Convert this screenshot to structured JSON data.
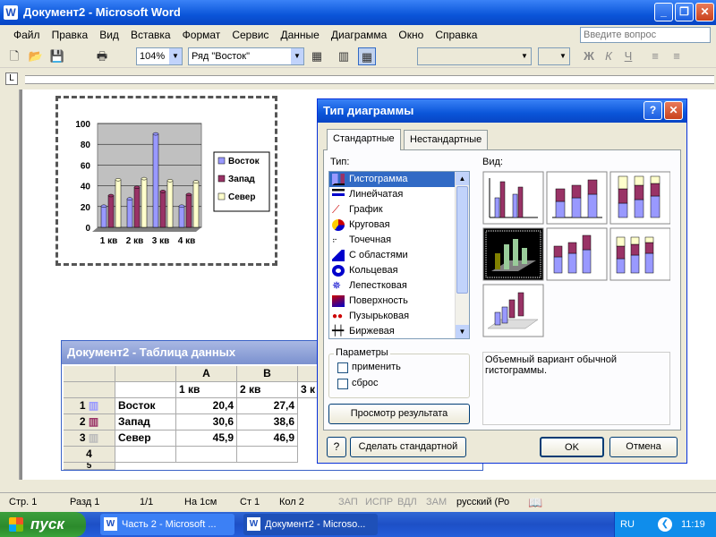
{
  "window": {
    "title": "Документ2 - Microsoft Word"
  },
  "menu": [
    "Файл",
    "Правка",
    "Вид",
    "Вставка",
    "Формат",
    "Сервис",
    "Данные",
    "Диаграмма",
    "Окно",
    "Справка"
  ],
  "search": {
    "placeholder": "Введите вопрос"
  },
  "toolbar": {
    "zoom": "104%",
    "series": "Ряд \"Восток\""
  },
  "chart_data": {
    "type": "bar",
    "categories": [
      "1 кв",
      "2 кв",
      "3 кв",
      "4 кв"
    ],
    "series": [
      {
        "name": "Восток",
        "values": [
          20.4,
          27.4,
          90,
          20.4
        ],
        "color": "#9999ff"
      },
      {
        "name": "Запад",
        "values": [
          30.6,
          38.6,
          34.6,
          31.6
        ],
        "color": "#993366"
      },
      {
        "name": "Север",
        "values": [
          45.9,
          46.9,
          45,
          43.9
        ],
        "color": "#ffffcc"
      }
    ],
    "ylim": [
      0,
      100
    ],
    "yticks": [
      "0",
      "20",
      "40",
      "60",
      "80",
      "100"
    ],
    "legend": "right"
  },
  "dialog": {
    "title": "Тип диаграммы",
    "tabs": [
      "Стандартные",
      "Нестандартные"
    ],
    "type_label": "Тип:",
    "view_label": "Вид:",
    "types": [
      "Гистограмма",
      "Линейчатая",
      "График",
      "Круговая",
      "Точечная",
      "С областями",
      "Кольцевая",
      "Лепестковая",
      "Поверхность",
      "Пузырьковая",
      "Биржевая"
    ],
    "params_label": "Параметры",
    "apply_label": "применить",
    "reset_label": "сброс",
    "preview_button": "Просмотр результата",
    "description": "Объемный вариант обычной гистограммы.",
    "make_default_button": "Сделать стандартной",
    "ok": "OK",
    "cancel": "Отмена"
  },
  "datasheet": {
    "title": "Документ2 - Таблица данных",
    "columns": [
      "A",
      "B"
    ],
    "headers": [
      "1 кв",
      "2 кв",
      "3 к"
    ],
    "rows": [
      {
        "num": "1",
        "label": "Восток",
        "a": "20,4",
        "b": "27,4"
      },
      {
        "num": "2",
        "label": "Запад",
        "a": "30,6",
        "b": "38,6"
      },
      {
        "num": "3",
        "label": "Север",
        "a": "45,9",
        "b": "46,9"
      },
      {
        "num": "4",
        "label": "",
        "a": "",
        "b": ""
      },
      {
        "num": "5",
        "label": "",
        "a": "",
        "b": ""
      }
    ]
  },
  "status": {
    "page": "Стр. 1",
    "section": "Разд 1",
    "pages": "1/1",
    "at": "На 1см",
    "line": "Ст 1",
    "col": "Кол 2",
    "rec": "ЗАП",
    "trk": "ИСПР",
    "ext": "ВДЛ",
    "ovr": "ЗАМ",
    "lang": "русский (Ро"
  },
  "taskbar": {
    "start": "пуск",
    "items": [
      "Часть 2 - Microsoft ...",
      "Документ2 - Microso..."
    ],
    "lang": "RU",
    "clock": "11:19"
  }
}
